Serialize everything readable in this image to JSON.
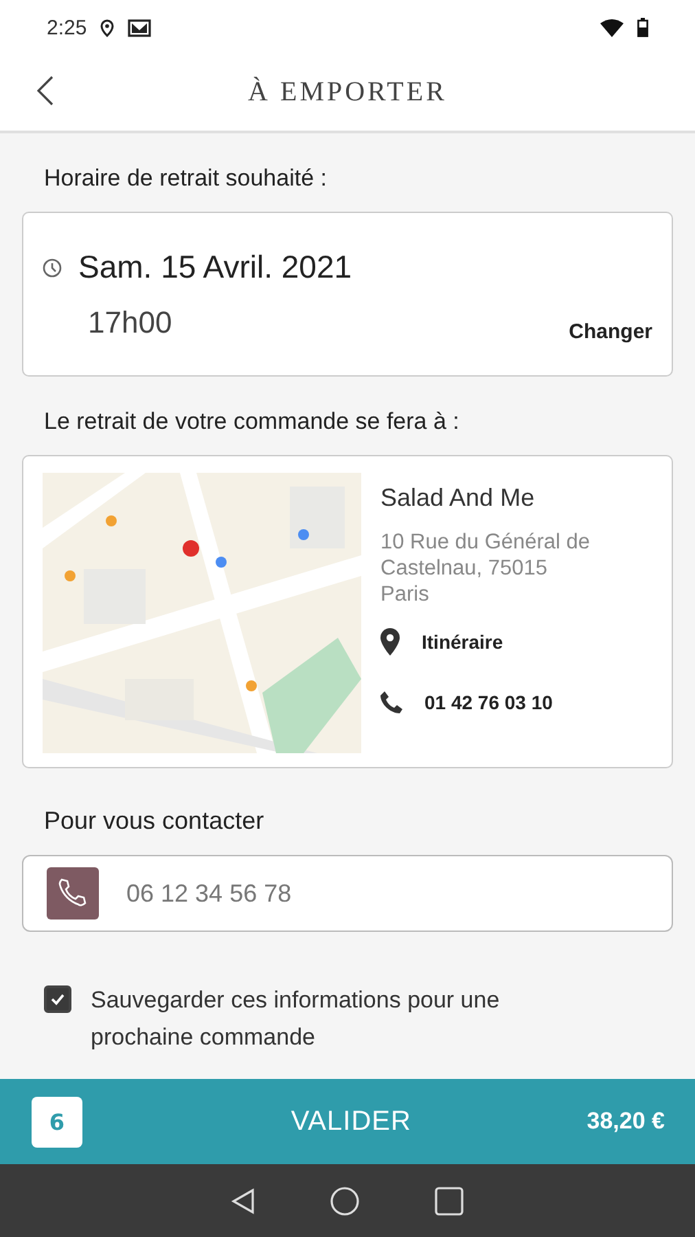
{
  "status_bar": {
    "time": "2:25"
  },
  "header": {
    "title": "À EMPORTER"
  },
  "pickup_time": {
    "label": "Horaire de retrait souhaité :",
    "date": "Sam. 15 Avril. 2021",
    "time": "17h00",
    "change": "Changer"
  },
  "pickup_place": {
    "label": "Le retrait de votre commande se fera à :",
    "name": "Salad And Me",
    "address": "10 Rue du Général de Castelnau, 75015 Paris",
    "directions": "Itinéraire",
    "phone": "01 42 76 03 10"
  },
  "contact": {
    "label": "Pour vous contacter",
    "placeholder": "06 12 34 56 78"
  },
  "save_info": {
    "label": "Sauvegarder ces informations pour une prochaine commande",
    "checked": true
  },
  "footer": {
    "count": "6",
    "action": "VALIDER",
    "total": "38,20 €"
  }
}
